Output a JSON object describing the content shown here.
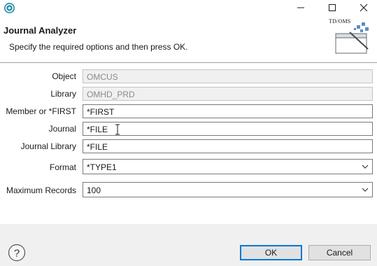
{
  "window": {
    "controls": {
      "minimize": "minimize",
      "maximize": "maximize",
      "close": "close"
    }
  },
  "header": {
    "title": "Journal Analyzer",
    "description": "Specify the required options and then press OK.",
    "badge_text": "TD/OMS"
  },
  "form": {
    "object": {
      "label": "Object",
      "value": "OMCUS",
      "enabled": false
    },
    "library": {
      "label": "Library",
      "value": "OMHD_PRD",
      "enabled": false
    },
    "member": {
      "label": "Member or *FIRST",
      "value": "*FIRST"
    },
    "journal": {
      "label": "Journal",
      "value": "*FILE"
    },
    "journal_library": {
      "label": "Journal Library",
      "value": "*FILE"
    },
    "format": {
      "label": "Format",
      "selected": "*TYPE1"
    },
    "max_records": {
      "label": "Maximum Records",
      "selected": "100"
    }
  },
  "buttons": {
    "ok": "OK",
    "cancel": "Cancel"
  },
  "colors": {
    "accent": "#0078d7",
    "footer_bg": "#f0f0f0",
    "disabled_bg": "#f0f0f0",
    "icon_teal": "#2a8fa8"
  },
  "icons": [
    "app-icon",
    "minimize-icon",
    "maximize-icon",
    "close-icon",
    "wizard-banner-icon",
    "chevron-down-icon",
    "help-icon"
  ]
}
